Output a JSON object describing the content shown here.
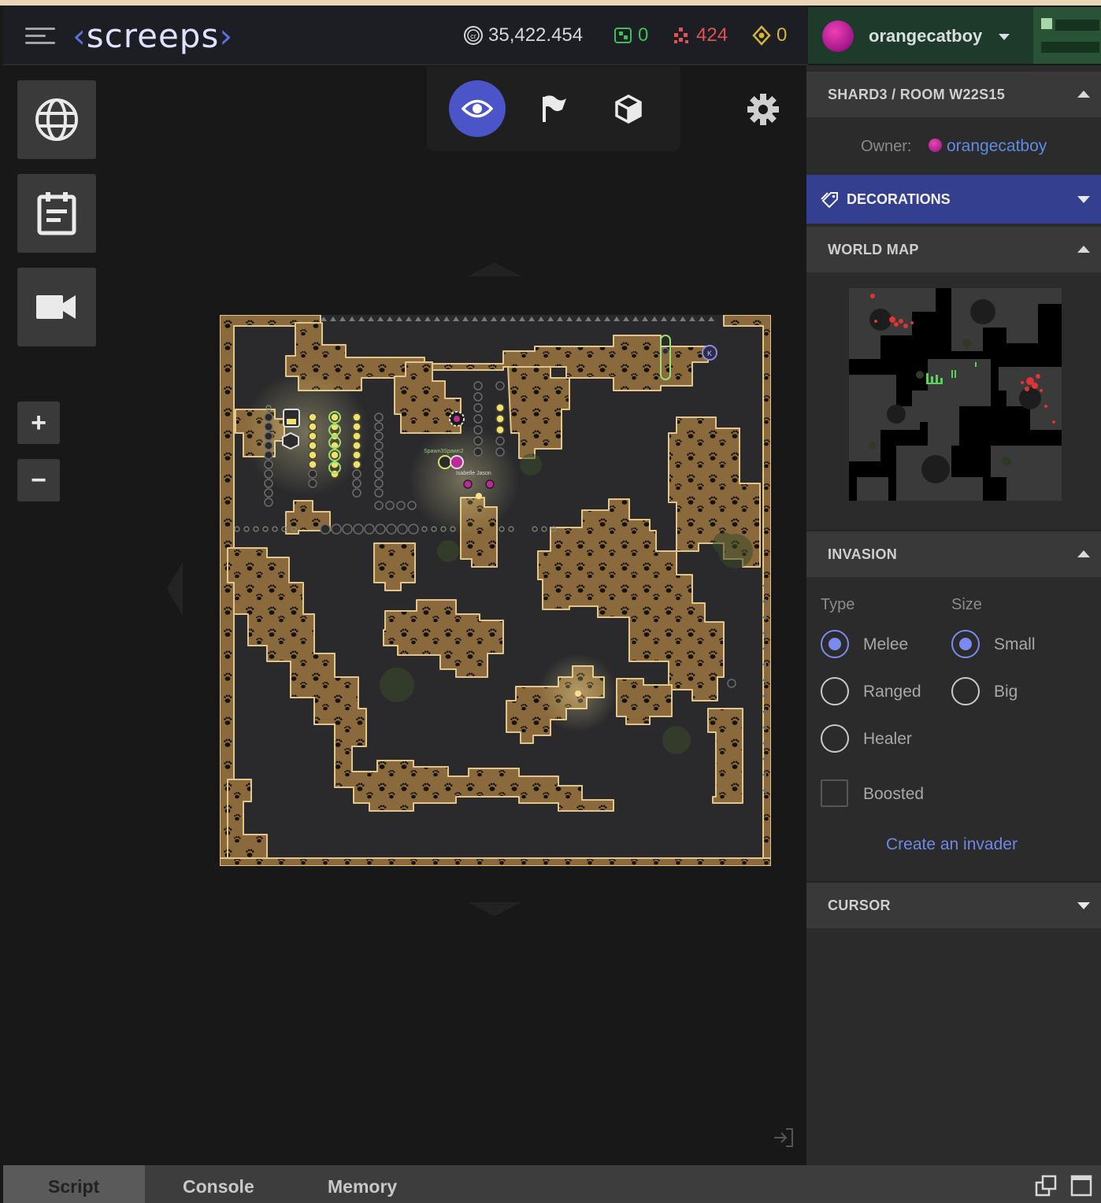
{
  "header": {
    "logo": "screeps",
    "stats": {
      "credits": "35,422.454",
      "cpu_unlock": "0",
      "pixels": "424",
      "access_keys": "0"
    },
    "username": "orangecatboy"
  },
  "colors": {
    "accent": "#5b6fe0",
    "credits": "#d7d7d7",
    "cpu_unlock": "#3fbf5a",
    "pixels": "#e15252",
    "access_keys": "#d4b43a",
    "user_green": "#1d3a2b",
    "decorations_bg": "#34408f",
    "link": "#5f8be3"
  },
  "toolbar": {
    "left_icons": [
      "globe-icon",
      "calendar-icon",
      "camera-icon"
    ],
    "zoom_in": "+",
    "zoom_out": "−",
    "modes": [
      "eye-icon",
      "flag-icon",
      "cube-icon"
    ],
    "active_mode": "eye-icon",
    "settings": "gear-icon"
  },
  "room_map": {
    "spawn_labels": "Spawn3Spawn2",
    "creep_labels": "Isabelle Jason",
    "marker": "K"
  },
  "panel": {
    "room": {
      "title": "SHARD3 / ROOM W22S15",
      "owner_label": "Owner:",
      "owner_name": "orangecatboy"
    },
    "decorations": {
      "title": "DECORATIONS"
    },
    "world_map": {
      "title": "WORLD MAP"
    },
    "invasion": {
      "title": "INVASION",
      "type_label": "Type",
      "size_label": "Size",
      "types": [
        "Melee",
        "Ranged",
        "Healer"
      ],
      "selected_type": "Melee",
      "sizes": [
        "Small",
        "Big"
      ],
      "selected_size": "Small",
      "boosted_label": "Boosted",
      "boosted": false,
      "create_link": "Create an invader"
    },
    "cursor": {
      "title": "CURSOR"
    }
  },
  "bottom_tabs": {
    "tabs": [
      "Script",
      "Console",
      "Memory"
    ],
    "active": "Script"
  }
}
